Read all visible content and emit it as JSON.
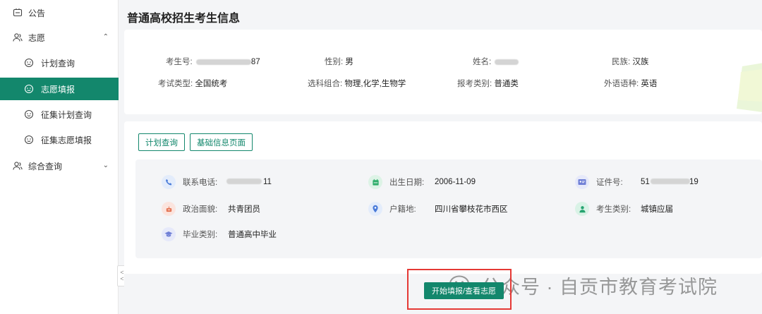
{
  "sidebar": {
    "items": [
      {
        "label": "公告",
        "icon": "notice-icon"
      },
      {
        "label": "志愿",
        "icon": "users-icon",
        "expanded": true
      },
      {
        "label": "计划查询",
        "icon": "smile-face-icon"
      },
      {
        "label": "志愿填报",
        "icon": "smile-face-icon",
        "active": true
      },
      {
        "label": "征集计划查询",
        "icon": "smile-face-icon"
      },
      {
        "label": "征集志愿填报",
        "icon": "smile-face-icon"
      },
      {
        "label": "综合查询",
        "icon": "users-icon",
        "expanded": false
      }
    ],
    "collapse_glyph": "<<"
  },
  "page_title": "普通高校招生考生信息",
  "top_info": {
    "exam_no": {
      "label": "考生号:",
      "value_suffix": "87"
    },
    "gender": {
      "label": "性别:",
      "value": "男"
    },
    "name": {
      "label": "姓名:"
    },
    "ethnicity": {
      "label": "民族:",
      "value": "汉族"
    },
    "exam_type": {
      "label": "考试类型:",
      "value": "全国统考"
    },
    "subjects": {
      "label": "选科组合:",
      "value": "物理,化学,生物学"
    },
    "category": {
      "label": "报考类别:",
      "value": "普通类"
    },
    "language": {
      "label": "外语语种:",
      "value": "英语"
    }
  },
  "buttons": {
    "plan_query": "计划查询",
    "basic_info": "基础信息页面",
    "start": "开始填报/查看志愿"
  },
  "details": {
    "phone": {
      "label": "联系电话:",
      "value_suffix": "11"
    },
    "birth": {
      "label": "出生日期:",
      "value": "2006-11-09"
    },
    "id_no": {
      "label": "证件号:",
      "value_prefix": "51",
      "value_suffix": "19"
    },
    "politics": {
      "label": "政治面貌:",
      "value": "共青团员"
    },
    "household": {
      "label": "户籍地:",
      "value": "四川省攀枝花市西区"
    },
    "student_type": {
      "label": "考生类别:",
      "value": "城镇应届"
    },
    "graduation": {
      "label": "毕业类别:",
      "value": "普通高中毕业"
    }
  },
  "watermark": "公众号 · 自贡市教育考试院",
  "colors": {
    "accent": "#13876c",
    "highlight": "#e53935"
  }
}
